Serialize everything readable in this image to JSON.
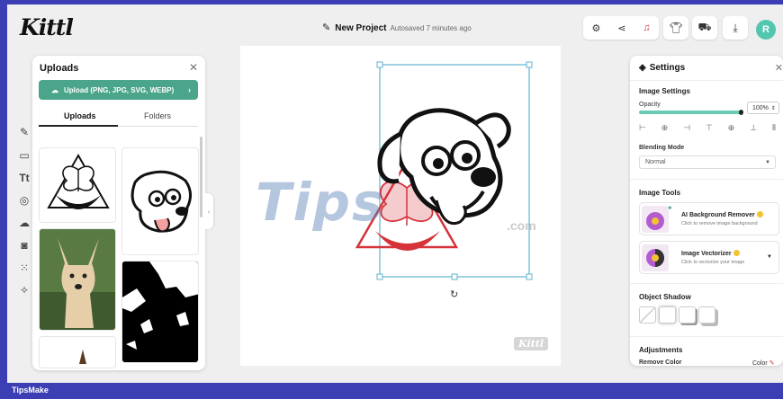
{
  "app": {
    "logo": "Kittl"
  },
  "header": {
    "project_name": "New Project",
    "autosave": "Autosaved 7 minutes ago",
    "avatar_initial": "R"
  },
  "uploads_panel": {
    "title": "Uploads",
    "upload_button": "Upload (PNG, JPG, SVG, WEBP)",
    "tabs": [
      "Uploads",
      "Folders"
    ]
  },
  "canvas": {
    "watermark": "Tips",
    "watermark_domain": ".com",
    "corner_logo": "Kittl"
  },
  "settings_panel": {
    "title": "Settings",
    "image_settings": "Image Settings",
    "opacity_label": "Opacity",
    "opacity_value": "100%",
    "opacity_fraction": 1.0,
    "blending_label": "Blending Mode",
    "blending_value": "Normal",
    "image_tools": "Image Tools",
    "tools": [
      {
        "name": "AI Background Remover",
        "desc": "Click to remove image background"
      },
      {
        "name": "Image Vectorizer",
        "desc": "Click to vectorize your image"
      }
    ],
    "object_shadow": "Object Shadow",
    "adjustments": "Adjustments",
    "remove_color": "Remove Color",
    "color": "Color"
  },
  "footer": {
    "label": "TipsMake"
  },
  "colors": {
    "accent": "#4aa58b",
    "brand_bar": "#3b3fb3",
    "selection": "#5fb3d3",
    "red": "#d6323a"
  }
}
